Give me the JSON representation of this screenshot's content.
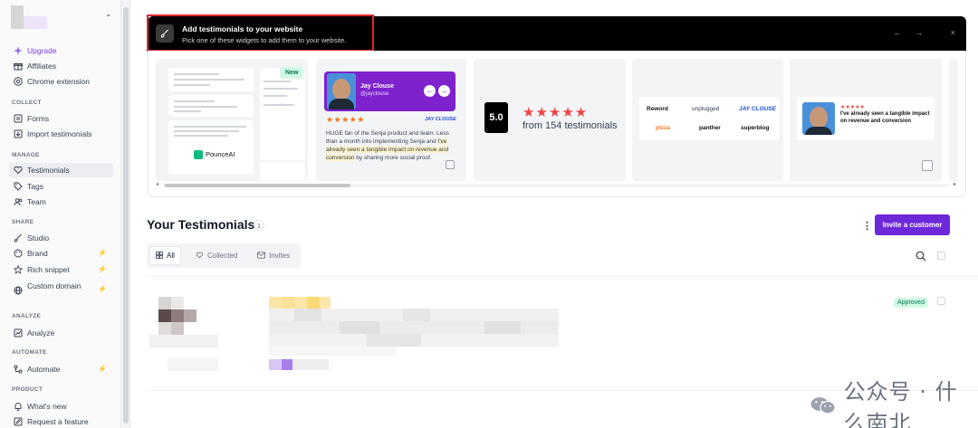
{
  "sidebar": {
    "items_top": [
      {
        "label": "Upgrade",
        "icon": "sparkle-icon"
      },
      {
        "label": "Affiliates",
        "icon": "gift-icon"
      },
      {
        "label": "Chrome extension",
        "icon": "chrome-icon"
      }
    ],
    "sections": {
      "collect": "COLLECT",
      "manage": "MANAGE",
      "share": "SHARE",
      "analyze": "ANALYZE",
      "automate": "AUTOMATE",
      "product": "PRODUCT"
    },
    "collect_items": [
      "Forms",
      "Import testimonials"
    ],
    "manage_items": [
      "Testimonials",
      "Tags",
      "Team"
    ],
    "share_items": [
      "Studio",
      "Brand",
      "Rich snippet",
      "Custom domain"
    ],
    "analyze_items": [
      "Analyze"
    ],
    "automate_items": [
      "Automate"
    ],
    "product_items": [
      "What's new",
      "Request a feature"
    ]
  },
  "banner": {
    "title": "Add testimonials to your website",
    "subtitle": "Pick one of these widgets to add them to your website.",
    "nav": "← →",
    "close": "×"
  },
  "widgets": {
    "new_badge": "New",
    "pounce_brand": "PounceAI",
    "card2": {
      "name": "Jay Clouse",
      "handle": "@jayclouse",
      "stars": "★★★★★",
      "logo": "JAY CLOUSE",
      "text_before": "HUGE fan of the Senja product and team. Less than a month into implementing Senja and ",
      "text_highlight": "I've already seen a tangible impact on revenue and conversion",
      "text_after": " by sharing more social proof."
    },
    "card3": {
      "rating": "5.0",
      "stars": "★★★★★",
      "from": "from 154 testimonials"
    },
    "card4_logos": [
      "Reword",
      "unplugged",
      "JAY CLOUSE",
      "pizza",
      "panther",
      "superblog"
    ],
    "card5": {
      "stars": "★★★★★",
      "text": "I've already seen a tangible impact on revenue and conversion"
    }
  },
  "testimonials": {
    "heading": "Your Testimonials",
    "count": "1",
    "invite_label": "Invite a customer",
    "tabs": [
      {
        "label": "All",
        "icon": "grid-icon"
      },
      {
        "label": "Collected",
        "icon": "heart-icon"
      },
      {
        "label": "Invites",
        "icon": "mail-icon"
      }
    ],
    "row_status": "Approved"
  },
  "watermark": {
    "text": "公众号 · 什么南北"
  },
  "colors": {
    "accent": "#6d28d9",
    "highlight_border": "#e0262d",
    "approved_bg": "#d1fae5",
    "approved_text": "#047857"
  }
}
